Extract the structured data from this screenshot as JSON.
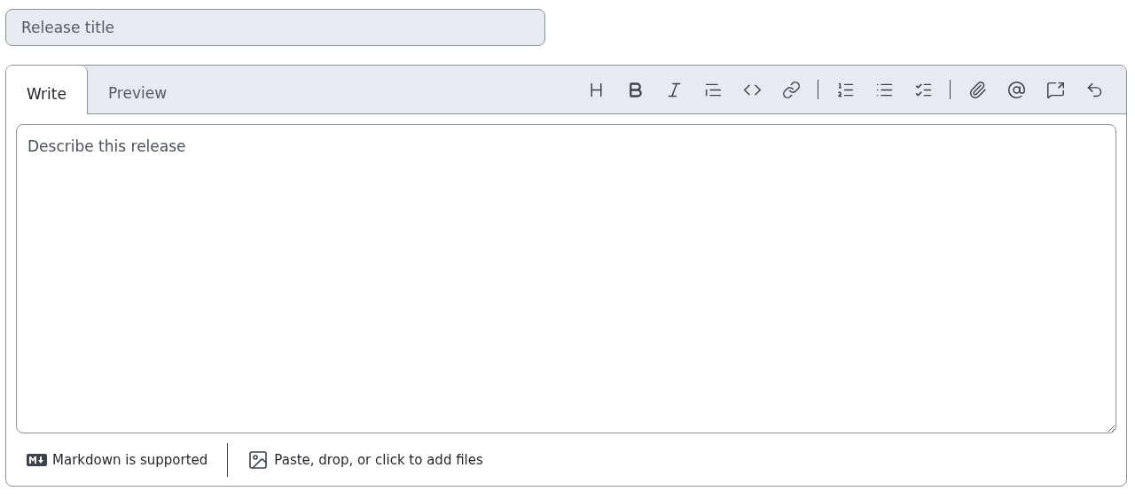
{
  "title_field": {
    "placeholder": "Release title"
  },
  "tabs": [
    {
      "label": "Write",
      "selected": true
    },
    {
      "label": "Preview",
      "selected": false
    }
  ],
  "editor": {
    "placeholder": "Describe this release"
  },
  "footer": {
    "markdown_note": "Markdown is supported",
    "attach_note": "Paste, drop, or click to add files"
  }
}
